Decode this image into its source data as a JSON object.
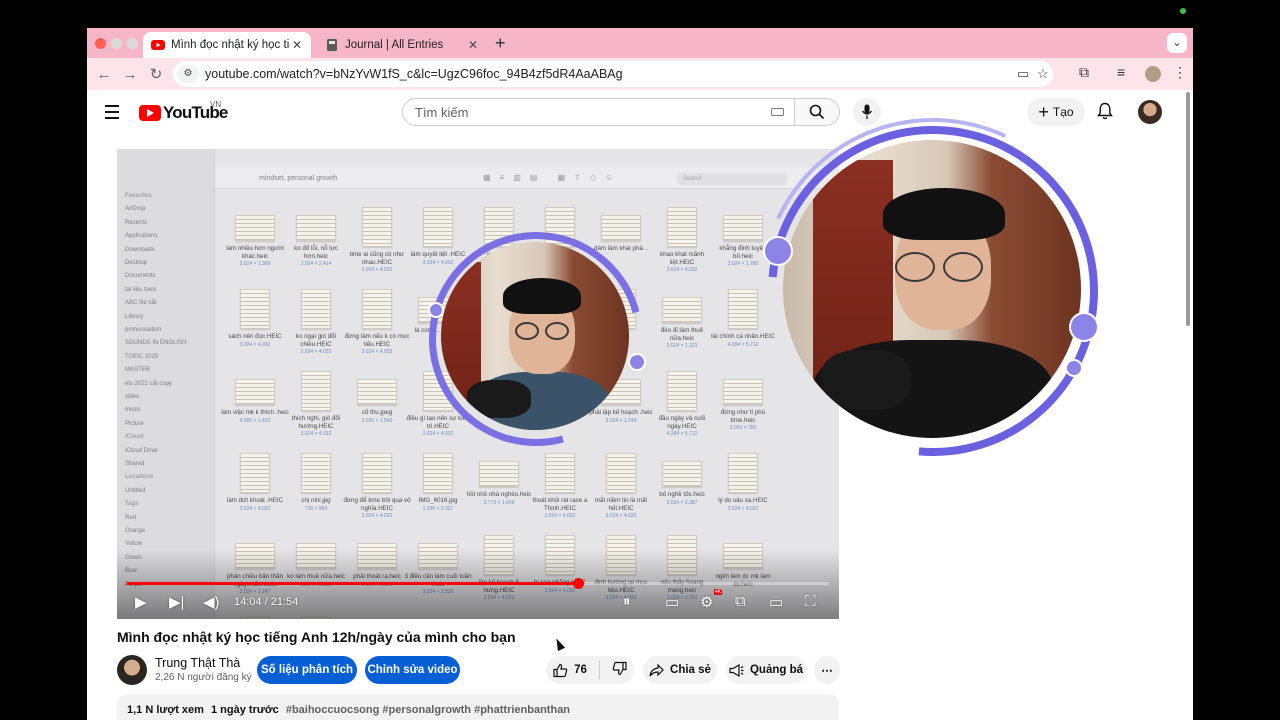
{
  "browser": {
    "tabs": [
      {
        "title": "Mình đọc nhật ký học tiếng Anh",
        "favicon": "youtube-icon",
        "active": true
      },
      {
        "title": "Journal | All Entries",
        "favicon": "journal-icon",
        "active": false
      }
    ],
    "url": "youtube.com/watch?v=bNzYvW1fS_c&lc=UgzC96foc_94B4zf5dR4AaABAg",
    "tabstrip_color": "#f7b6c7"
  },
  "youtube": {
    "logo_text": "YouTube",
    "country": "VN",
    "search_placeholder": "Tìm kiếm",
    "create_label": "Tạo"
  },
  "video": {
    "time_current": "14:04",
    "time_total": "21:54",
    "progress": 0.6425,
    "hd_badge": "4K",
    "finder": {
      "path": "mindset, personal growth",
      "search_placeholder": "Search",
      "sidebar": [
        {
          "label": "Favorites",
          "header": true
        },
        {
          "label": "AirDrop"
        },
        {
          "label": "Recents"
        },
        {
          "label": "Applications"
        },
        {
          "label": "Downloads"
        },
        {
          "label": "Desktop"
        },
        {
          "label": "Documents"
        },
        {
          "label": "tài liệu toeic"
        },
        {
          "label": "ABC file cắt"
        },
        {
          "label": "Library"
        },
        {
          "label": "pronunciation"
        },
        {
          "label": "SOUNDS IN ENGLISH"
        },
        {
          "label": "TOEIC 2025"
        },
        {
          "label": "MASTER"
        },
        {
          "label": "ets 2022 cắt copy"
        },
        {
          "label": "video"
        },
        {
          "label": "music"
        },
        {
          "label": "Picture"
        },
        {
          "label": "iCloud",
          "header": true
        },
        {
          "label": "iCloud Drive"
        },
        {
          "label": "Shared"
        },
        {
          "label": "Locations",
          "header": true
        },
        {
          "label": "Untitled"
        },
        {
          "label": "Tags",
          "header": true
        },
        {
          "label": "Red"
        },
        {
          "label": "Orange"
        },
        {
          "label": "Yellow"
        },
        {
          "label": "Green"
        },
        {
          "label": "Blue"
        },
        {
          "label": "Purple"
        }
      ],
      "files": [
        {
          "name": "làm nhiều hơn người khác.heic",
          "size": "3.024 × 1.369",
          "shape": "wide"
        },
        {
          "name": "ko đổ lỗi, nỗ lực hơn.heic",
          "size": "3.024 × 2.414",
          "shape": "wide"
        },
        {
          "name": "time ai cũng có như nhau.HEIC",
          "size": "3.024 × 4.032",
          "shape": "tall"
        },
        {
          "name": "làm quyết liệt .HEIC",
          "size": "3.024 × 4.032",
          "shape": "tall"
        },
        {
          "name": "sự kiên...",
          "size": "",
          "shape": "tall"
        },
        {
          "name": "",
          "size": "",
          "shape": "tall"
        },
        {
          "name": "dám làm khai phá...",
          "size": "",
          "shape": "wide"
        },
        {
          "name": "khao khát mãnh liệt.HEIC",
          "size": "3.024 × 4.032",
          "shape": "tall"
        },
        {
          "name": "khẳng định tuyên bố.heic",
          "size": "3.024 × 1.780",
          "shape": "wide"
        },
        {
          "name": "sách nên đọc.HEIC",
          "size": "3.024 × 4.032",
          "shape": "tall"
        },
        {
          "name": "ko ngại gió đổi chiều.HEIC",
          "size": "3.024 × 4.032",
          "shape": "tall"
        },
        {
          "name": "đừng làm nếu k có mục tiêu.HEIC",
          "size": "3.024 × 4.032",
          "shape": "tall"
        },
        {
          "name": "là con t... làm c...",
          "size": "",
          "shape": "wide"
        },
        {
          "name": "",
          "size": "",
          "shape": "tall"
        },
        {
          "name": "",
          "size": "",
          "shape": "tall"
        },
        {
          "name": "",
          "size": "",
          "shape": "tall"
        },
        {
          "name": "đèo đi làm thuê nữa.heic",
          "size": "3.024 × 1.323",
          "shape": "wide"
        },
        {
          "name": "tài chính cá nhân.HEIC",
          "size": "4.284 × 5.712",
          "shape": "tall"
        },
        {
          "name": "làm việc mk k thích .heic",
          "size": "4.000 × 1.432",
          "shape": "wide"
        },
        {
          "name": "thích nghi, gió đổi hướng.HEIC",
          "size": "3.024 × 4.032",
          "shape": "tall"
        },
        {
          "name": "cố thu.jpeg",
          "size": "2.026 × 1.540",
          "shape": "wide"
        },
        {
          "name": "điều gì tạo nên sự kiên trì.HEIC",
          "size": "3.024 × 4.032",
          "shape": "tall"
        },
        {
          "name": "",
          "size": "",
          "shape": "tall"
        },
        {
          "name": "",
          "size": "",
          "shape": "tall"
        },
        {
          "name": "phải lập kế hoạch .heic",
          "size": "3.024 × 1.249",
          "shape": "wide"
        },
        {
          "name": "đầu ngày và cuối ngày.HEIC",
          "size": "4.284 × 5.712",
          "shape": "tall"
        },
        {
          "name": "đừng như tí phú time.heic",
          "size": "3.024 × 782",
          "shape": "wide"
        },
        {
          "name": "làm dứt khoát .HEIC",
          "size": "3.024 × 4.032",
          "shape": "tall"
        },
        {
          "name": "chị nini.jpg",
          "size": "716 × 954",
          "shape": "tall"
        },
        {
          "name": "đừng để time trôi qua vô nghĩa.HEIC",
          "size": "3.024 × 4.032",
          "shape": "tall"
        },
        {
          "name": "IMG_6016.jpg",
          "size": "1.290 × 2.327",
          "shape": "tall"
        },
        {
          "name": "hồi nhỏ nhà nghèo.heic",
          "size": "2.773 × 1.649",
          "shape": "wide"
        },
        {
          "name": "thoát khỏi rat race a Thịnh.HEIC",
          "size": "3.024 × 4.032",
          "shape": "tall"
        },
        {
          "name": "mất niềm tin là mất hết.HEIC",
          "size": "3.024 × 4.032",
          "shape": "tall"
        },
        {
          "name": "bỏ nghề tốc.heic",
          "size": "3.024 × 2.387",
          "shape": "wide"
        },
        {
          "name": "lý do sâu xa.HEIC",
          "size": "3.024 × 4.032",
          "shape": "tall"
        },
        {
          "name": "phân chiều bản thân ngày...năm.heic",
          "size": "3.024 × 2.247",
          "shape": "wide"
        },
        {
          "name": "ko làm thuê nữa.heic",
          "size": "3.024 × 2.338",
          "shape": "wide"
        },
        {
          "name": "phải thoát ra.heic",
          "size": "3.024 × 1.378",
          "shape": "wide"
        },
        {
          "name": "3 điều cần làm cuối tuần .heic",
          "size": "3.024 × 2.830",
          "shape": "wide"
        },
        {
          "name": "lập kế hoạch S hưng.HEIC",
          "size": "3.024 × 4.032",
          "shape": "tall"
        },
        {
          "name": "bị xao nhãng.HEIC",
          "size": "3.024 × 4.032",
          "shape": "tall"
        },
        {
          "name": "định hướng lại mục tiêu.HEIC",
          "size": "3.024 × 4.032",
          "shape": "tall"
        },
        {
          "name": "nếu thấy hoang mang.heic",
          "size": "3.024 × 2.353",
          "shape": "tall"
        },
        {
          "name": "ngkh làm dc mk làm dc.heic",
          "size": "",
          "shape": "wide"
        },
        {
          "name": "mk vừng đáng nhưng...",
          "size": "",
          "shape": "tall"
        },
        {
          "name": "sh/ngay 3-5 time.heic",
          "size": "",
          "shape": "tall"
        },
        {
          "name": "lệch hướng, dừng lại.heic",
          "size": "",
          "shape": "wide"
        }
      ]
    }
  },
  "meta": {
    "title": "Mình đọc nhật ký học tiếng Anh 12h/ngày của mình cho bạn",
    "channel_name": "Trung Thật Thà",
    "subscribers": "2,26 N người đăng ký",
    "analytics_button": "Số liệu phân tích",
    "edit_button": "Chỉnh sửa video",
    "likes": "76",
    "share_label": "Chia sẻ",
    "promote_label": "Quảng bá",
    "views": "1,1 N lượt xem",
    "published": "1 ngày trước",
    "hashtags": "#baihoccuocsong #personalgrowth #phattrienbanthan"
  },
  "colors": {
    "accent_blue": "#065fd4",
    "ring_purple": "#8c84e6",
    "progress_red": "#ff0000"
  }
}
